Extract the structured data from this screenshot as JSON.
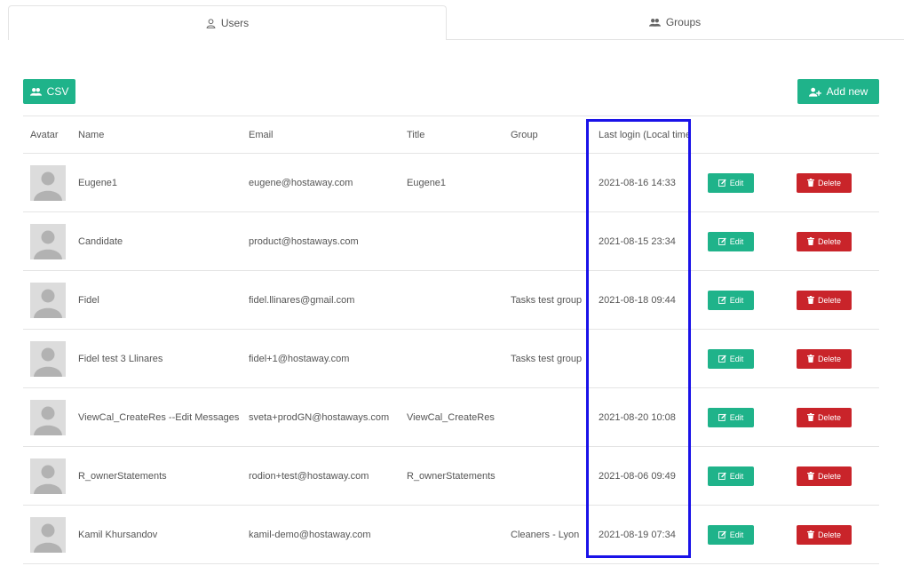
{
  "tabs": {
    "users": "Users",
    "groups": "Groups"
  },
  "toolbar": {
    "csv_label": "CSV",
    "add_new_label": "Add new"
  },
  "table": {
    "headers": {
      "avatar": "Avatar",
      "name": "Name",
      "email": "Email",
      "title": "Title",
      "group": "Group",
      "last_login": "Last login (Local time"
    },
    "edit_label": "Edit",
    "delete_label": "Delete",
    "rows": [
      {
        "name": "Eugene1",
        "email": "eugene@hostaway.com",
        "title": "Eugene1",
        "group": "",
        "last_login": "2021-08-16 14:33"
      },
      {
        "name": "Candidate",
        "email": "product@hostaways.com",
        "title": "",
        "group": "",
        "last_login": "2021-08-15 23:34"
      },
      {
        "name": "Fidel",
        "email": "fidel.llinares@gmail.com",
        "title": "",
        "group": "Tasks test group",
        "last_login": "2021-08-18 09:44"
      },
      {
        "name": "Fidel test 3 Llinares",
        "email": "fidel+1@hostaway.com",
        "title": "",
        "group": "Tasks test group",
        "last_login": ""
      },
      {
        "name": "ViewCal_CreateRes --Edit Messages",
        "email": "sveta+prodGN@hostaways.com",
        "title": "ViewCal_CreateRes",
        "group": "",
        "last_login": "2021-08-20 10:08"
      },
      {
        "name": "R_ownerStatements",
        "email": "rodion+test@hostaway.com",
        "title": "R_ownerStatements",
        "group": "",
        "last_login": "2021-08-06 09:49"
      },
      {
        "name": "Kamil Khursandov",
        "email": "kamil-demo@hostaway.com",
        "title": "",
        "group": "Cleaners - Lyon",
        "last_login": "2021-08-19 07:34"
      }
    ]
  },
  "colors": {
    "accent": "#1fb38a",
    "danger": "#c9242a",
    "highlight": "#1a12e8"
  },
  "icons": {
    "users_tab": "user-outline-icon",
    "groups_tab": "users-group-icon",
    "csv": "users-group-icon",
    "add_new": "user-plus-icon",
    "edit": "edit-icon",
    "delete": "trash-icon",
    "avatar": "default-avatar-icon"
  }
}
